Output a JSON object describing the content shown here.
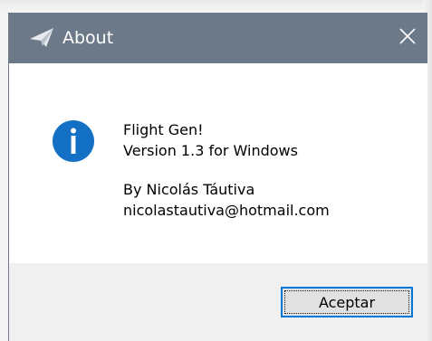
{
  "window": {
    "title": "About",
    "title_icon": "paper-plane-icon",
    "close_icon": "close-icon"
  },
  "content": {
    "icon": "info-icon",
    "app_name": "Flight Gen!",
    "version": "Version 1.3 for Windows",
    "author": "By Nicolás Táutiva",
    "email": "nicolastautiva@hotmail.com"
  },
  "footer": {
    "ok_label": "Aceptar"
  },
  "colors": {
    "titlebar": "#6b7989",
    "info_icon": "#1470c4",
    "button_border": "#0078d7"
  }
}
